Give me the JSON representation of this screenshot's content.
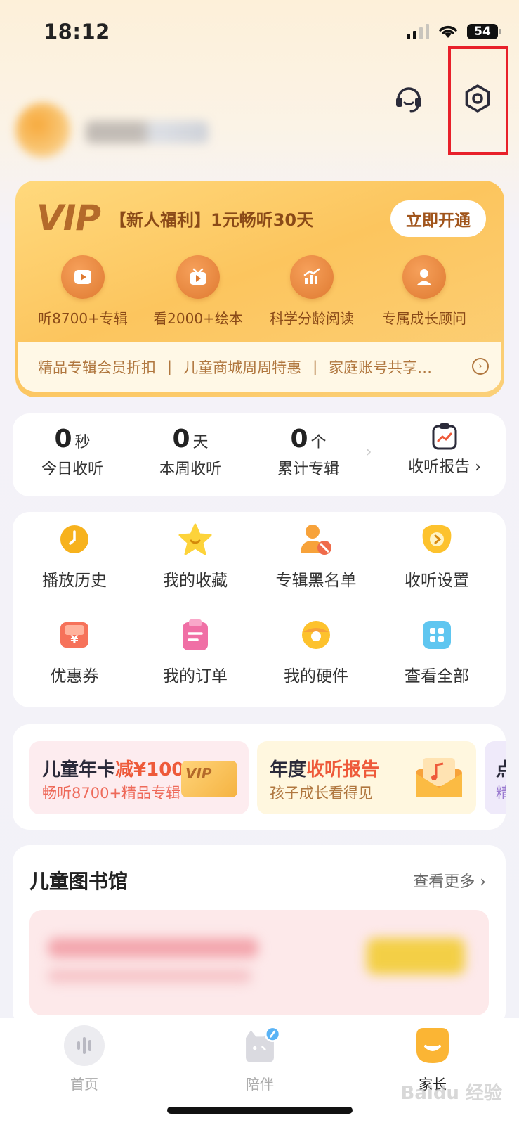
{
  "status_bar": {
    "time": "18:12",
    "battery": "54"
  },
  "header": {
    "support_icon": "headset-icon",
    "settings_icon": "gear-icon"
  },
  "vip": {
    "logo": "VIP",
    "title": "【新人福利】1元畅听30天",
    "button": "立即开通",
    "benefits": [
      {
        "label": "听8700+专辑",
        "icon": "play-icon"
      },
      {
        "label": "看2000+绘本",
        "icon": "tv-play-icon"
      },
      {
        "label": "科学分龄阅读",
        "icon": "growth-chart-icon"
      },
      {
        "label": "专属成长顾问",
        "icon": "advisor-icon"
      }
    ],
    "strip": [
      "精品专辑会员折扣",
      "儿童商城周周特惠",
      "家庭账号共享…"
    ],
    "separator": "|"
  },
  "stats": {
    "items": [
      {
        "num": "0",
        "unit": "秒",
        "label": "今日收听"
      },
      {
        "num": "0",
        "unit": "天",
        "label": "本周收听"
      },
      {
        "num": "0",
        "unit": "个",
        "label": "累计专辑"
      }
    ],
    "report_label": "收听报告 ›"
  },
  "menu": {
    "items": [
      {
        "label": "播放历史",
        "icon": "history-icon"
      },
      {
        "label": "我的收藏",
        "icon": "star-icon"
      },
      {
        "label": "专辑黑名单",
        "icon": "blocked-user-icon"
      },
      {
        "label": "收听设置",
        "icon": "listen-settings-icon"
      },
      {
        "label": "优惠券",
        "icon": "coupon-icon"
      },
      {
        "label": "我的订单",
        "icon": "order-icon"
      },
      {
        "label": "我的硬件",
        "icon": "hardware-icon"
      },
      {
        "label": "查看全部",
        "icon": "grid-icon"
      }
    ]
  },
  "promos": [
    {
      "title_a": "儿童年卡",
      "title_b": "减¥100",
      "sub": "畅听8700+精品专辑"
    },
    {
      "title_a": "年度",
      "title_b": "收听报告",
      "sub": "孩子成长看得见"
    },
    {
      "title_a": "点",
      "sub": "精"
    }
  ],
  "library": {
    "title": "儿童图书馆",
    "more": "查看更多 ›"
  },
  "tabs": [
    {
      "label": "首页",
      "icon": "home-wave-icon"
    },
    {
      "label": "陪伴",
      "icon": "companion-icon"
    },
    {
      "label": "家长",
      "icon": "parent-icon"
    }
  ],
  "watermark": "Baidu 经验",
  "colors": {
    "accent": "#f5c042",
    "highlight_box": "#e8202a",
    "vip_text": "#8a4a18"
  }
}
